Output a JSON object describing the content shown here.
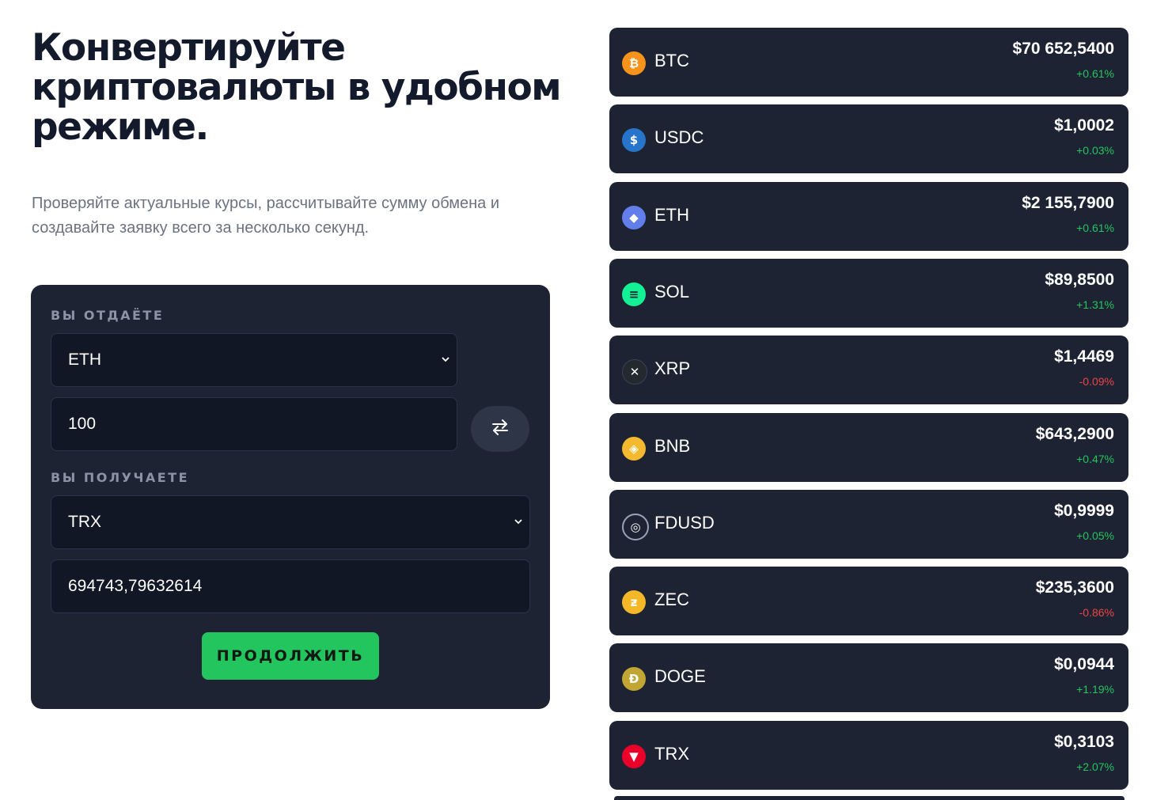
{
  "hero": {
    "title": "Конвертируйте криптовалюты в удобном режиме.",
    "subtitle": "Проверяйте актуальные курсы, рассчитывайте сумму обмена и создавайте заявку всего за несколько секунд."
  },
  "converter": {
    "give_label": "ВЫ ОТДАЁТЕ",
    "give_currency": "ETH",
    "give_amount": "100",
    "get_label": "ВЫ ПОЛУЧАЕТЕ",
    "get_currency": "TRX",
    "get_amount": "694743,79632614",
    "continue_label": "ПРОДОЛЖИТЬ"
  },
  "colors": {
    "card_bg": "#1d2333",
    "accent_green": "#23c55e",
    "positive": "#22c55e",
    "negative": "#ef4444"
  },
  "rates": [
    {
      "symbol": "BTC",
      "price": "$70 652,5400",
      "change": "+0.61%",
      "trend": "up",
      "icon": "bitcoin-icon",
      "icon_color": "#f7931a",
      "glyph": "₿"
    },
    {
      "symbol": "USDC",
      "price": "$1,0002",
      "change": "+0.03%",
      "trend": "up",
      "icon": "usdc-icon",
      "icon_color": "#2775ca",
      "glyph": "$"
    },
    {
      "symbol": "ETH",
      "price": "$2 155,7900",
      "change": "+0.61%",
      "trend": "up",
      "icon": "ethereum-icon",
      "icon_color": "#627eea",
      "glyph": "◆"
    },
    {
      "symbol": "SOL",
      "price": "$89,8500",
      "change": "+1.31%",
      "trend": "up",
      "icon": "solana-icon",
      "icon_color": "#14f195",
      "glyph": "≡"
    },
    {
      "symbol": "XRP",
      "price": "$1,4469",
      "change": "-0.09%",
      "trend": "down",
      "icon": "xrp-icon",
      "icon_color": "#23292f",
      "glyph": "✕"
    },
    {
      "symbol": "BNB",
      "price": "$643,2900",
      "change": "+0.47%",
      "trend": "up",
      "icon": "bnb-icon",
      "icon_color": "#f3ba2f",
      "glyph": "◈"
    },
    {
      "symbol": "FDUSD",
      "price": "$0,9999",
      "change": "+0.05%",
      "trend": "up",
      "icon": "fdusd-icon",
      "icon_color": "#1d2333",
      "glyph": "◎"
    },
    {
      "symbol": "ZEC",
      "price": "$235,3600",
      "change": "-0.86%",
      "trend": "down",
      "icon": "zcash-icon",
      "icon_color": "#f4b728",
      "glyph": "ƶ"
    },
    {
      "symbol": "DOGE",
      "price": "$0,0944",
      "change": "+1.19%",
      "trend": "up",
      "icon": "dogecoin-icon",
      "icon_color": "#c2a633",
      "glyph": "Ð"
    },
    {
      "symbol": "TRX",
      "price": "$0,3103",
      "change": "+2.07%",
      "trend": "up",
      "icon": "tron-icon",
      "icon_color": "#eb0029",
      "glyph": "▼"
    }
  ]
}
